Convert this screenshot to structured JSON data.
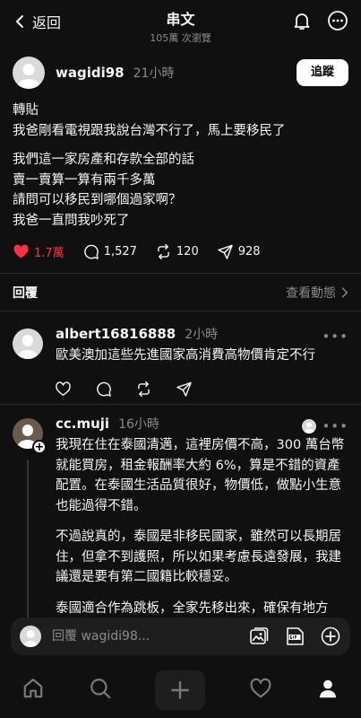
{
  "header": {
    "back_label": "返回",
    "title": "串文",
    "views": "105萬 次瀏覽"
  },
  "post": {
    "username": "wagidi98",
    "time": "21小時",
    "follow_label": "追蹤",
    "paragraphs": [
      [
        "轉貼",
        "我爸剛看電視跟我說台灣不行了，馬上要移民了"
      ],
      [
        "我們這一家房產和存款全部的話",
        "賣一賣算一算有兩千多萬",
        "請問可以移民到哪個過家啊？",
        "我爸一直問我吵死了"
      ]
    ],
    "likes": "1.7萬",
    "comments": "1,527",
    "reposts": "120",
    "shares": "928"
  },
  "replies_section": {
    "label": "回覆",
    "activity_label": "查看動態"
  },
  "replies": [
    {
      "username": "albert16816888",
      "time": "2小時",
      "text": "歐美澳加這些先進國家高消費高物價肯定不行"
    },
    {
      "username": "cc.muji",
      "time": "16小時",
      "paragraphs": [
        "我現在住在泰國清邁，這裡房價不高，300 萬台幣就能買房，租金報酬率大約 6%，算是不錯的資產配置。在泰國生活品質很好，物價低，做點小生意也能過得不錯。",
        "不過說真的，泰國是非移民國家，雖然可以長期居住，但拿不到護照，所以如果考慮長遠發展，我建議還是要有第二國籍比較穩妥。",
        "泰國適合作為跳板，全家先移出來，確保有地方"
      ]
    }
  ],
  "composer": {
    "placeholder": "回覆 wagidi98..."
  },
  "colors": {
    "background": "#101010",
    "like": "#ff3040",
    "muted": "#8a8a8a"
  }
}
